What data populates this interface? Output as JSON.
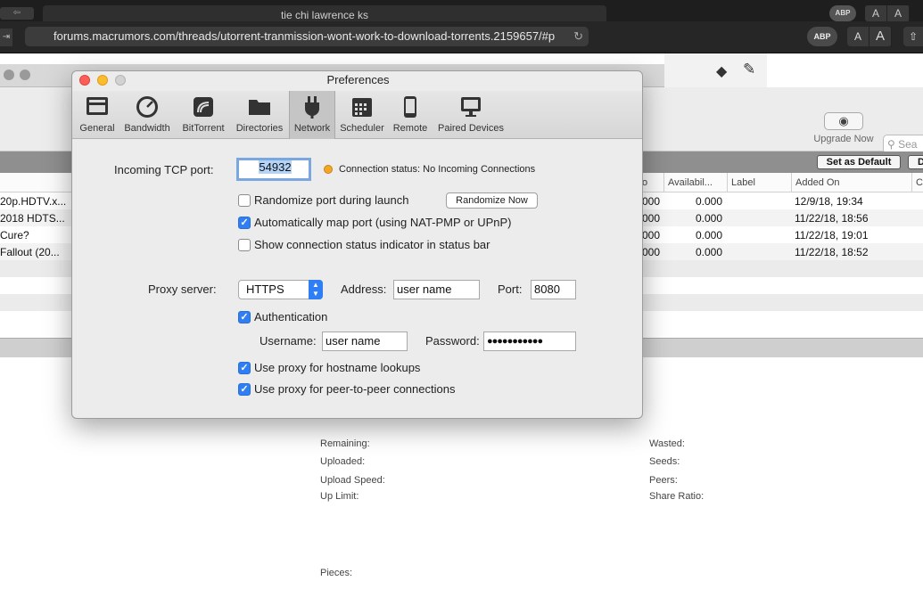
{
  "browser": {
    "tab_title": "tie chi lawrence ks",
    "url": "forums.macrumors.com/threads/utorrent-tranmission-wont-work-to-download-torrents.2159657/#p",
    "abp": "ABP",
    "text_small": "A",
    "text_large": "A"
  },
  "app": {
    "upgrade_label": "Upgrade Now",
    "search_placeholder": "Sea",
    "set_default_label": "Set as Default",
    "columns": [
      "o",
      "Availabil...",
      "Label",
      "Added On",
      "C"
    ],
    "rows": [
      {
        "name": "20p.HDTV.x...",
        "o": "000",
        "avail": "0.000",
        "added": "12/9/18, 19:34"
      },
      {
        "name": "2018 HDTS...",
        "o": "000",
        "avail": "0.000",
        "added": "11/22/18, 18:56"
      },
      {
        "name": "Cure?",
        "o": "000",
        "avail": "0.000",
        "added": "11/22/18, 19:01"
      },
      {
        "name": "Fallout (20...",
        "o": "000",
        "avail": "0.000",
        "added": "11/22/18, 18:52"
      }
    ],
    "info": {
      "remaining": "Remaining:",
      "uploaded": "Uploaded:",
      "upload_speed": "Upload Speed:",
      "up_limit": "Up Limit:",
      "wasted": "Wasted:",
      "seeds": "Seeds:",
      "peers": "Peers:",
      "share_ratio": "Share Ratio:",
      "pieces": "Pieces:"
    }
  },
  "prefs": {
    "title": "Preferences",
    "tabs": [
      {
        "label": "General",
        "icon": "general-icon"
      },
      {
        "label": "Bandwidth",
        "icon": "speedometer-icon"
      },
      {
        "label": "BitTorrent",
        "icon": "bittorrent-icon"
      },
      {
        "label": "Directories",
        "icon": "folder-icon"
      },
      {
        "label": "Network",
        "icon": "plug-icon"
      },
      {
        "label": "Scheduler",
        "icon": "calendar-icon"
      },
      {
        "label": "Remote",
        "icon": "phone-icon"
      },
      {
        "label": "Paired Devices",
        "icon": "monitor-icon"
      }
    ],
    "active_tab": "Network",
    "incoming_port_label": "Incoming TCP port:",
    "incoming_port_value": "54932",
    "connection_status": "Connection status: No Incoming Connections",
    "randomize_launch_label": "Randomize port during launch",
    "randomize_launch_checked": false,
    "randomize_now_label": "Randomize Now",
    "auto_map_label": "Automatically map port (using NAT-PMP or UPnP)",
    "auto_map_checked": true,
    "show_status_label": "Show connection status indicator in status bar",
    "show_status_checked": false,
    "proxy_server_label": "Proxy server:",
    "proxy_type": "HTTPS",
    "address_label": "Address:",
    "address_value": "user name",
    "port_label": "Port:",
    "port_value": "8080",
    "auth_label": "Authentication",
    "auth_checked": true,
    "username_label": "Username:",
    "username_value": "user name",
    "password_label": "Password:",
    "password_value": "●●●●●●●●●●●",
    "hostname_lookups_label": "Use proxy for hostname lookups",
    "hostname_lookups_checked": true,
    "p2p_label": "Use proxy for peer-to-peer connections",
    "p2p_checked": true
  },
  "colors": {
    "accent": "#2f7ef3",
    "status_dot": "#f5a623",
    "close": "#fc5f57",
    "minimize": "#fdbc2e"
  }
}
